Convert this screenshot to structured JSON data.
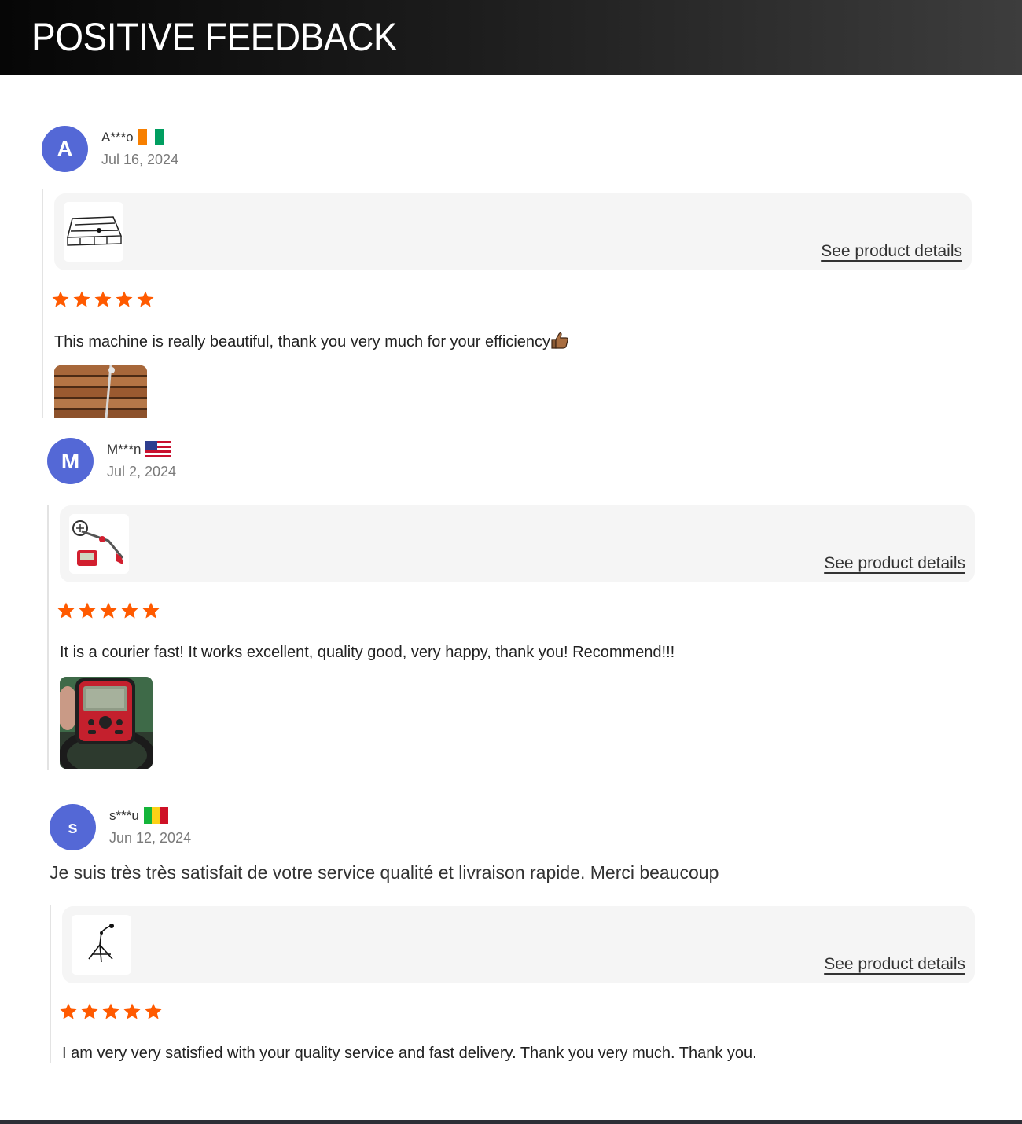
{
  "header": {
    "title": "POSITIVE FEEDBACK"
  },
  "colors": {
    "avatar": "#5468d6",
    "star": "#ff5a00",
    "card": "#f5f5f5"
  },
  "reviews": [
    {
      "avatar_letter": "A",
      "username": "A***o",
      "flag": "ivory-coast-flag",
      "date": "Jul 16, 2024",
      "product_link": "See product details",
      "product_icon": "trampoline-frame-icon",
      "rating": 5,
      "text": "This machine is really beautiful, thank you very much for your efficiency",
      "emoji": "thumbs-up-icon",
      "photo": "wooden-pallet-photo"
    },
    {
      "avatar_letter": "M",
      "username": "M***n",
      "flag": "usa-flag",
      "date": "Jul 2, 2024",
      "product_link": "See product details",
      "product_icon": "metal-detector-icon",
      "rating": 5,
      "text": "It is a courier fast! It works excellent, quality good, very happy, thank you! Recommend!!!",
      "photo": "metal-detector-screen-photo"
    },
    {
      "avatar_letter": "s",
      "username": "s***u",
      "flag": "mali-flag",
      "date": "Jun 12, 2024",
      "comment": "Je suis très très satisfait de votre service qualité et livraison rapide. Merci beaucoup",
      "product_link": "See product details",
      "product_icon": "tripod-stand-icon",
      "rating": 5,
      "text": "I am very very satisfied with your quality service and fast delivery. Thank you very much. Thank you."
    }
  ]
}
